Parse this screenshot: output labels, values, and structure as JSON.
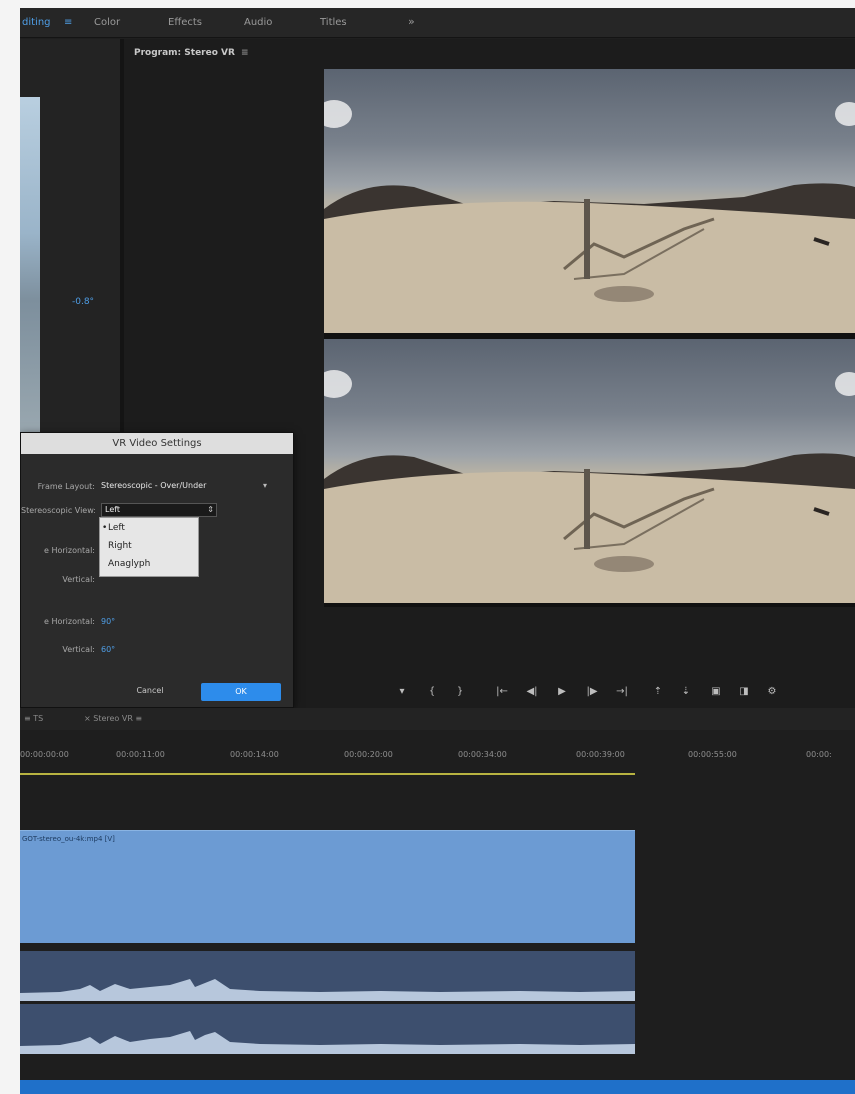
{
  "workspace": {
    "tabs": [
      {
        "label": "diting",
        "active": true
      },
      {
        "label": "Color"
      },
      {
        "label": "Effects"
      },
      {
        "label": "Audio"
      },
      {
        "label": "Titles"
      }
    ],
    "separator": "≡",
    "more": "»"
  },
  "source_panel": {
    "angle_readout": "-0.8°"
  },
  "program_monitor": {
    "title": "Program: Stereo VR",
    "menu": "≡",
    "transport": {
      "marker": "▾",
      "in": "{",
      "out": "}",
      "goto_in": "|←",
      "step_back": "◀|",
      "play": "▶",
      "step_fwd": "|▶",
      "goto_out": "→|",
      "lift": "⇡",
      "extract": "⇣",
      "export_frame": "▣",
      "vr": "◨",
      "settings": "⚙"
    }
  },
  "vr_dialog": {
    "title": "VR Video Settings",
    "frame_layout_label": "Frame Layout:",
    "frame_layout_value": "Stereoscopic - Over/Under",
    "stereo_view_label": "Stereoscopic View:",
    "stereo_view_value": "Left",
    "captured_view_label": "e Horizontal:",
    "captured_vertical_label": "Vertical:",
    "monitor_view_label": "e Horizontal:",
    "monitor_view_value": "90°",
    "monitor_vertical_label": "Vertical:",
    "monitor_vertical_value": "60°",
    "dropdown_options": [
      "Left",
      "Right",
      "Anaglyph"
    ],
    "selected_option": "Left",
    "cancel_label": "Cancel",
    "ok_label": "OK"
  },
  "timeline": {
    "tabs": [
      {
        "label": "≡ TS"
      },
      {
        "label": "× Stereo VR ≡"
      }
    ],
    "ruler_ticks": [
      "00:00:00:00",
      "00:00:11:00",
      "00:00:14:00",
      "00:00:20:00",
      "00:00:34:00",
      "00:00:39:00",
      "00:00:55:00",
      "00:00:"
    ],
    "video_clip_label": "GOT-stereo_ou-4k:mp4 [V]"
  },
  "colors": {
    "accent": "#2d8ceb",
    "clip_video": "#6c9bd3",
    "clip_audio": "#3d4f6e",
    "work_area": "#b8b341",
    "status_bar": "#1f70c9"
  }
}
